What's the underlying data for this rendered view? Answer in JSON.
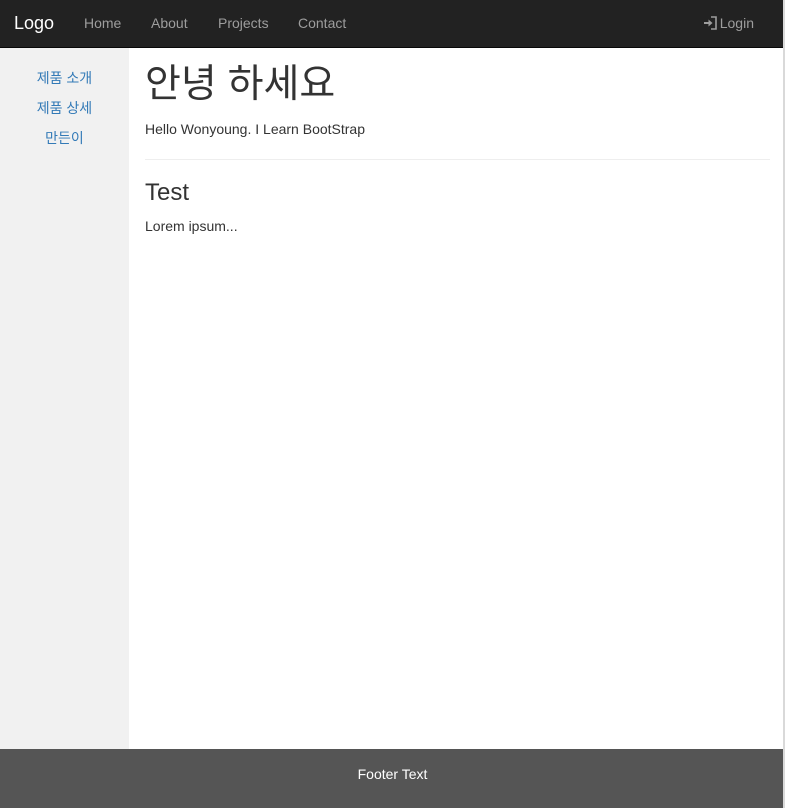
{
  "navbar": {
    "brand": "Logo",
    "links": [
      "Home",
      "About",
      "Projects",
      "Contact"
    ],
    "login_label": "Login",
    "login_icon": "log-in-icon"
  },
  "sidebar": {
    "items": [
      {
        "label": "제품 소개"
      },
      {
        "label": "제품 상세"
      },
      {
        "label": "만든이"
      }
    ]
  },
  "main": {
    "title": "안녕 하세요",
    "intro": "Hello Wonyoung. I Learn BootStrap",
    "section_title": "Test",
    "section_text": "Lorem ipsum..."
  },
  "footer": {
    "text": "Footer Text"
  },
  "colors": {
    "navbar_bg": "#222222",
    "nav_link": "#9d9d9d",
    "sidebar_bg": "#f1f1f1",
    "link_blue": "#337ab7",
    "footer_bg": "#555555"
  }
}
